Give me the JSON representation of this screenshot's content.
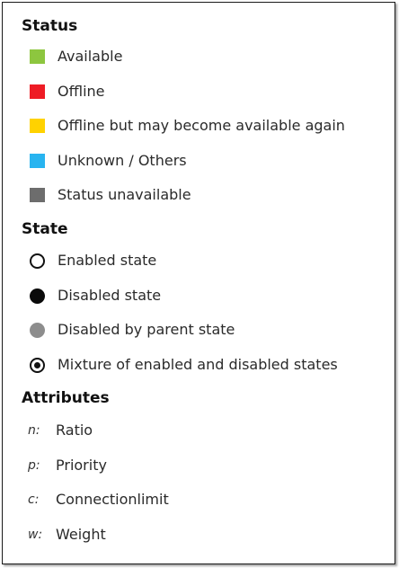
{
  "status": {
    "title": "Status",
    "items": [
      {
        "label": "Available",
        "color": "#8dc63f"
      },
      {
        "label": "Offline",
        "color": "#ee1c25"
      },
      {
        "label": "Offline but may become available again",
        "color": "#ffd200"
      },
      {
        "label": "Unknown / Others",
        "color": "#28b4f0"
      },
      {
        "label": "Status unavailable",
        "color": "#6d6d6d"
      }
    ]
  },
  "state": {
    "title": "State",
    "items": [
      {
        "label": "Enabled state",
        "icon": "open-circle-icon"
      },
      {
        "label": "Disabled state",
        "icon": "filled-circle-icon"
      },
      {
        "label": "Disabled by parent state",
        "icon": "grey-circle-icon"
      },
      {
        "label": "Mixture of enabled and disabled states",
        "icon": "dotted-circle-icon"
      }
    ]
  },
  "attributes": {
    "title": "Attributes",
    "items": [
      {
        "key": "n:",
        "label": "Ratio"
      },
      {
        "key": "p:",
        "label": "Priority"
      },
      {
        "key": "c:",
        "label": "Connectionlimit"
      },
      {
        "key": "w:",
        "label": "Weight"
      }
    ]
  }
}
